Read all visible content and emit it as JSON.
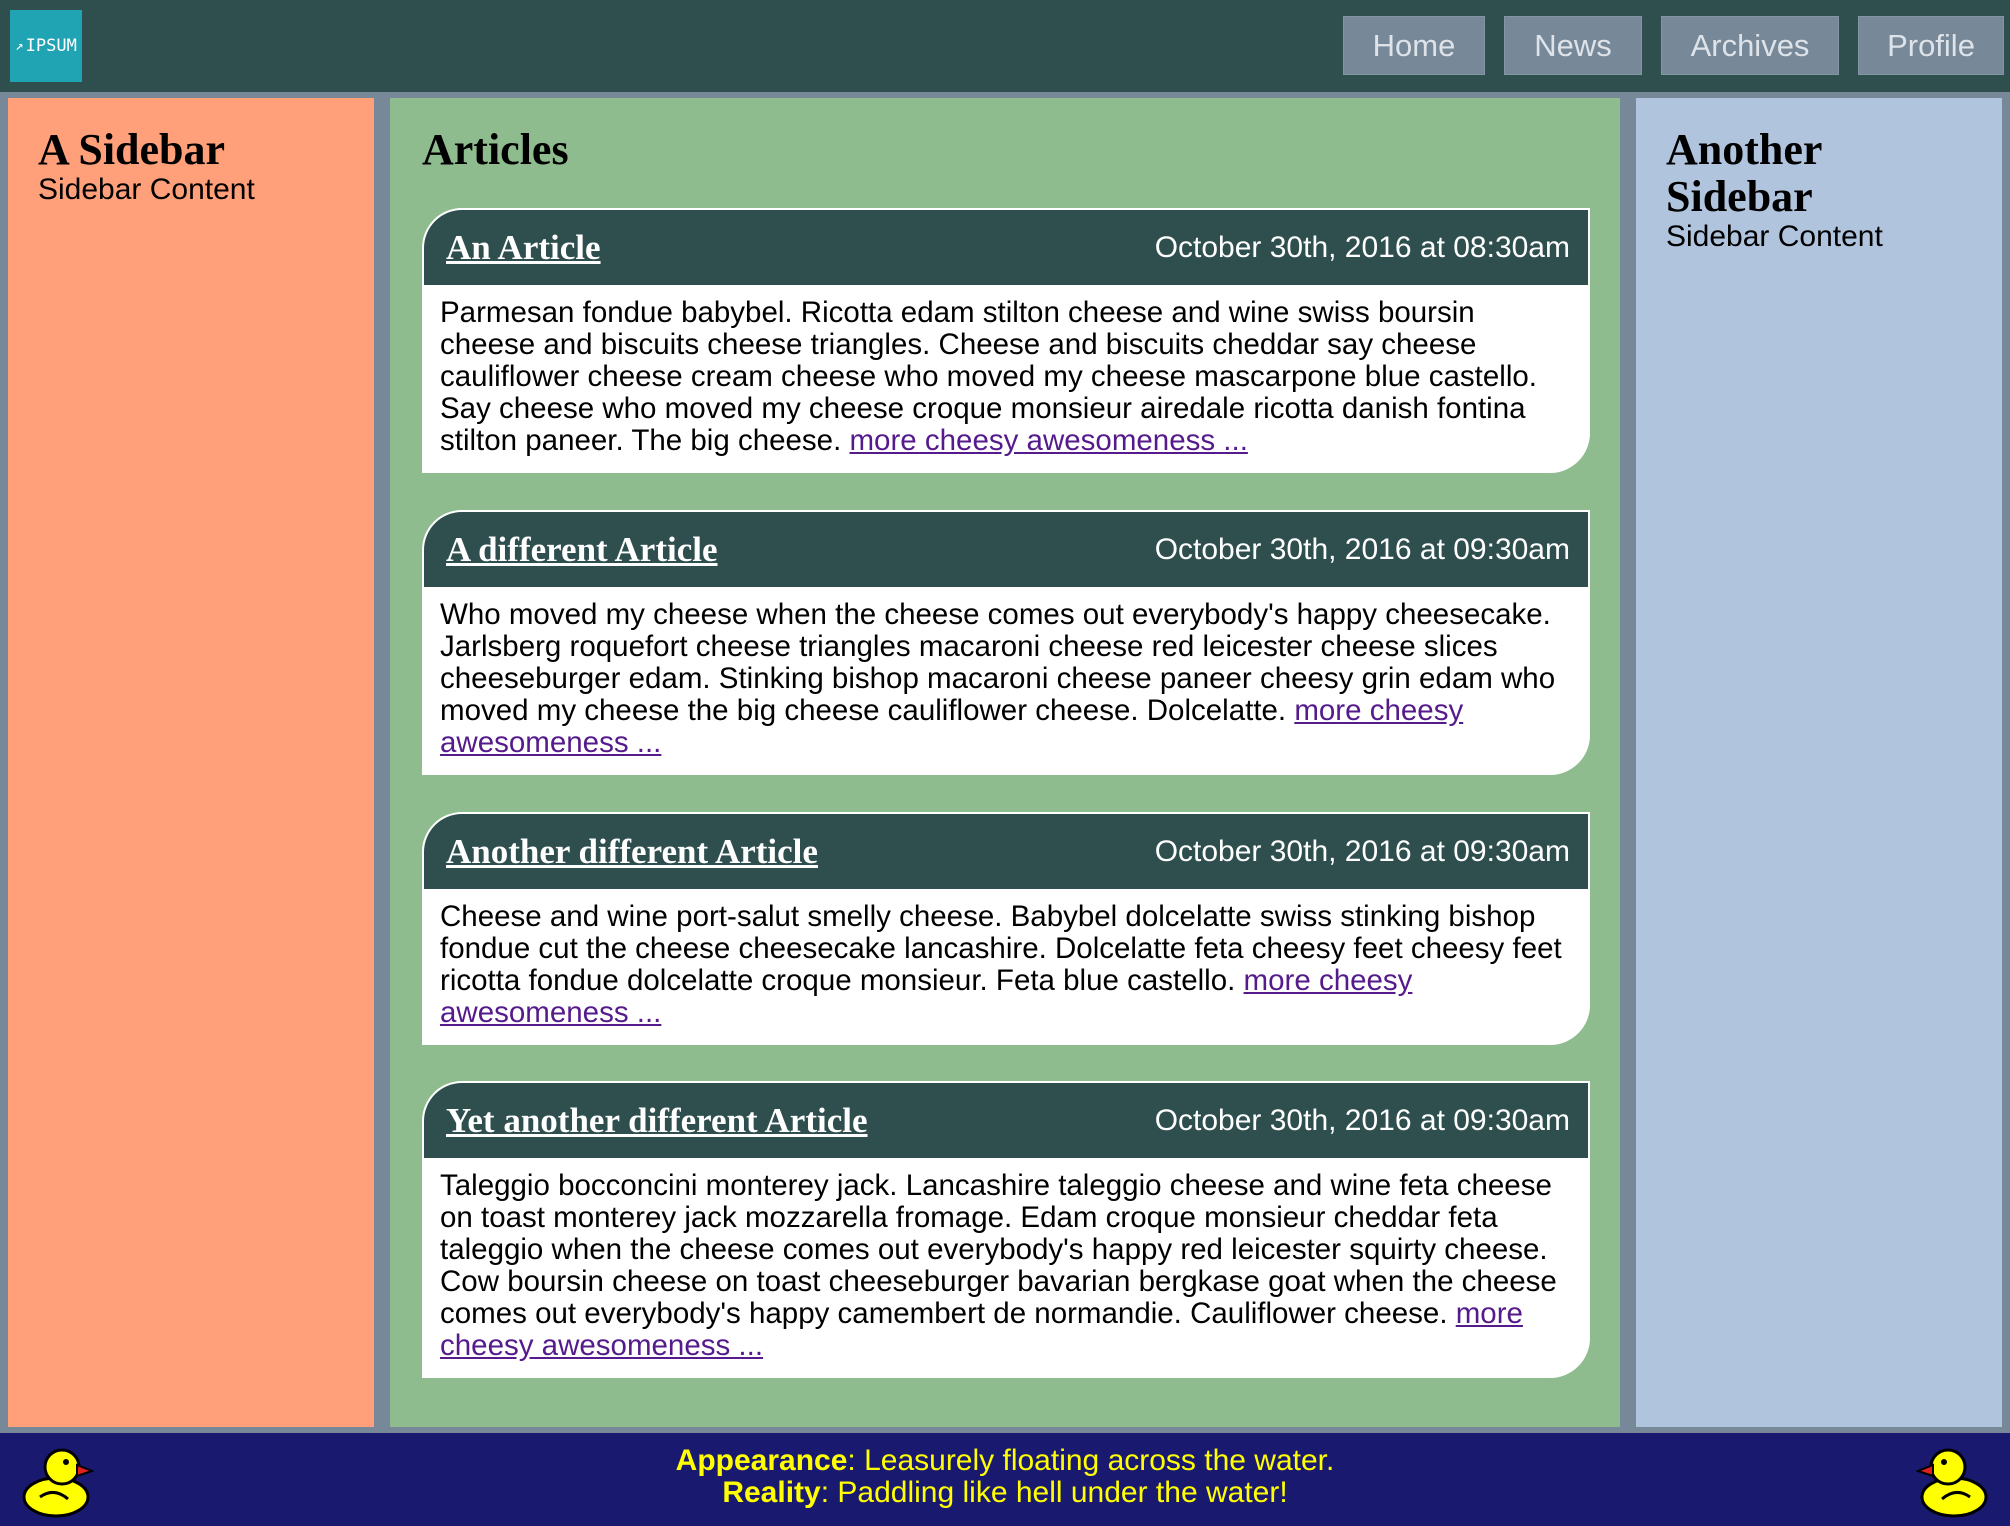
{
  "header": {
    "logo_text": "IPSUM",
    "nav": [
      {
        "label": "Home"
      },
      {
        "label": "News"
      },
      {
        "label": "Archives"
      },
      {
        "label": "Profile"
      }
    ]
  },
  "left_sidebar": {
    "title": "A Sidebar",
    "content": "Sidebar Content"
  },
  "main": {
    "title": "Articles",
    "articles": [
      {
        "title": "An Article",
        "date": "October 30th, 2016 at 08:30am",
        "body": "Parmesan fondue babybel. Ricotta edam stilton cheese and wine swiss boursin cheese and biscuits cheese triangles. Cheese and biscuits cheddar say cheese cauliflower cheese cream cheese who moved my cheese mascarpone blue castello. Say cheese who moved my cheese croque monsieur airedale ricotta danish fontina stilton paneer. The big cheese.",
        "more": "more cheesy awesomeness ..."
      },
      {
        "title": "A different Article",
        "date": "October 30th, 2016 at 09:30am",
        "body": "Who moved my cheese when the cheese comes out everybody's happy cheesecake. Jarlsberg roquefort cheese triangles macaroni cheese red leicester cheese slices cheeseburger edam. Stinking bishop macaroni cheese paneer cheesy grin edam who moved my cheese the big cheese cauliflower cheese. Dolcelatte.",
        "more": "more cheesy awesomeness ..."
      },
      {
        "title": "Another different Article",
        "date": "October 30th, 2016 at 09:30am",
        "body": "Cheese and wine port-salut smelly cheese. Babybel dolcelatte swiss stinking bishop fondue cut the cheese cheesecake lancashire. Dolcelatte feta cheesy feet cheesy feet ricotta fondue dolcelatte croque monsieur. Feta blue castello.",
        "more": "more cheesy awesomeness ..."
      },
      {
        "title": "Yet another different Article",
        "date": "October 30th, 2016 at 09:30am",
        "body": "Taleggio bocconcini monterey jack. Lancashire taleggio cheese and wine feta cheese on toast monterey jack mozzarella fromage. Edam croque monsieur cheddar feta taleggio when the cheese comes out everybody's happy red leicester squirty cheese. Cow boursin cheese on toast cheeseburger bavarian bergkase goat when the cheese comes out everybody's happy camembert de normandie. Cauliflower cheese.",
        "more": "more cheesy awesomeness ..."
      }
    ]
  },
  "right_sidebar": {
    "title": "Another Sidebar",
    "content": "Sidebar Content"
  },
  "footer": {
    "line1_label": "Appearance",
    "line1_text": ": Leasurely floating across the water.",
    "line2_label": "Reality",
    "line2_text": ": Paddling like hell under the water!",
    "icons": [
      "duck-icon",
      "duck-icon"
    ]
  },
  "colors": {
    "header_bg": "#2f4f4f",
    "page_bg": "#778899",
    "left_sidebar_bg": "#ffa07a",
    "main_bg": "#8fbc8f",
    "right_sidebar_bg": "#b0c4de",
    "footer_bg": "#191970",
    "footer_text": "#ffff00",
    "link_visited": "#551a8b"
  }
}
